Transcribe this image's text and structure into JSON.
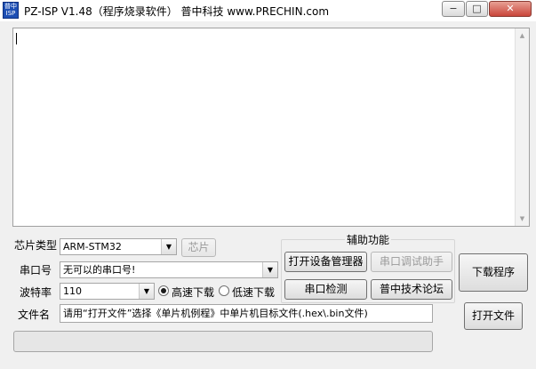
{
  "window": {
    "icon_top": "普中",
    "icon_bottom": "ISP",
    "title": "PZ-ISP V1.48（程序烧录软件）  普中科技  www.PRECHIN.com",
    "min_symbol": "−",
    "max_symbol": "□",
    "close_symbol": "✕"
  },
  "chip": {
    "label": "芯片类型",
    "value": "ARM-STM32",
    "chip_button": "芯片"
  },
  "port": {
    "label": "串口号",
    "value": "无可以的串口号!"
  },
  "baud": {
    "label": "波特率",
    "value": "110",
    "high_speed": "高速下载",
    "low_speed": "低速下载",
    "selected": "high_speed"
  },
  "aux": {
    "title": "辅助功能",
    "device_manager": "打开设备管理器",
    "serial_assistant": "串口调试助手",
    "serial_detect": "串口检测",
    "forum": "普中技术论坛"
  },
  "file": {
    "label": "文件名",
    "hint": "请用“打开文件”选择《单片机例程》中单片机目标文件(.hex\\.bin文件)"
  },
  "actions": {
    "download": "下载程序",
    "open_file": "打开文件"
  },
  "progress": 0,
  "icons": {
    "dropdown": "▼",
    "scroll_up": "▲",
    "scroll_down": "▼"
  }
}
